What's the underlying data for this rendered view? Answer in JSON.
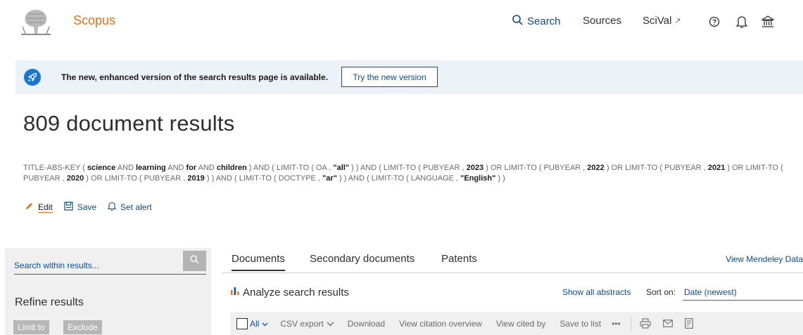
{
  "header": {
    "brand": "Scopus",
    "nav": {
      "search": "Search",
      "sources": "Sources",
      "scival": "SciVal",
      "scival_ext": "↗"
    },
    "icons": [
      "search-icon",
      "help-icon",
      "bell-icon",
      "institution-icon"
    ]
  },
  "banner": {
    "text": "The new, enhanced version of the search results page is available.",
    "button": "Try the new version"
  },
  "results": {
    "title": "809 document results"
  },
  "query": {
    "segments": [
      {
        "t": "TITLE-ABS-KEY ( ",
        "b": false
      },
      {
        "t": "science",
        "b": true
      },
      {
        "t": " AND ",
        "b": false
      },
      {
        "t": "learning",
        "b": true
      },
      {
        "t": " AND ",
        "b": false
      },
      {
        "t": "for",
        "b": true
      },
      {
        "t": " AND ",
        "b": false
      },
      {
        "t": "children",
        "b": true
      },
      {
        "t": " ) AND ( LIMIT-TO ( OA , ",
        "b": false
      },
      {
        "t": "\"all\"",
        "b": true
      },
      {
        "t": " ) ) AND ( LIMIT-TO ( PUBYEAR , ",
        "b": false
      },
      {
        "t": "2023",
        "b": true
      },
      {
        "t": " ) OR LIMIT-TO ( PUBYEAR , ",
        "b": false
      },
      {
        "t": "2022",
        "b": true
      },
      {
        "t": " ) OR LIMIT-TO ( PUBYEAR , ",
        "b": false
      },
      {
        "t": "2021",
        "b": true
      },
      {
        "t": " ) OR LIMIT-TO ( PUBYEAR , ",
        "b": false
      },
      {
        "t": "2020",
        "b": true
      },
      {
        "t": " ) OR LIMIT-TO ( PUBYEAR , ",
        "b": false
      },
      {
        "t": "2019",
        "b": true
      },
      {
        "t": " ) ) AND ( LIMIT-TO ( DOCTYPE , ",
        "b": false
      },
      {
        "t": "\"ar\"",
        "b": true
      },
      {
        "t": " ) ) AND ( LIMIT-TO ( LANGUAGE , ",
        "b": false
      },
      {
        "t": "\"English\"",
        "b": true
      },
      {
        "t": " ) )",
        "b": false
      }
    ]
  },
  "query_actions": {
    "edit": "Edit",
    "save": "Save",
    "set_alert": "Set alert"
  },
  "sidebar": {
    "search_placeholder": "Search within results...",
    "refine": "Refine results",
    "limit_to": "Limit to",
    "exclude": "Exclude"
  },
  "main": {
    "tabs": [
      {
        "label": "Documents",
        "active": true
      },
      {
        "label": "Secondary documents",
        "active": false
      },
      {
        "label": "Patents",
        "active": false
      }
    ],
    "mendeley": "View Mendeley Data",
    "analyze": "Analyze search results",
    "show_abstracts": "Show all abstracts",
    "sort_label": "Sort on:",
    "sort_value": "Date (newest)"
  },
  "toolbar": {
    "all": "All",
    "csv_export": "CSV export",
    "download": "Download",
    "citation_overview": "View citation overview",
    "cited_by": "View cited by",
    "save_to_list": "Save to list",
    "more": "•••"
  },
  "colors": {
    "brand": "#e9711c",
    "link": "#0e4c8a",
    "banner_bg": "#ebf2f8",
    "rocket": "#1776d1"
  }
}
